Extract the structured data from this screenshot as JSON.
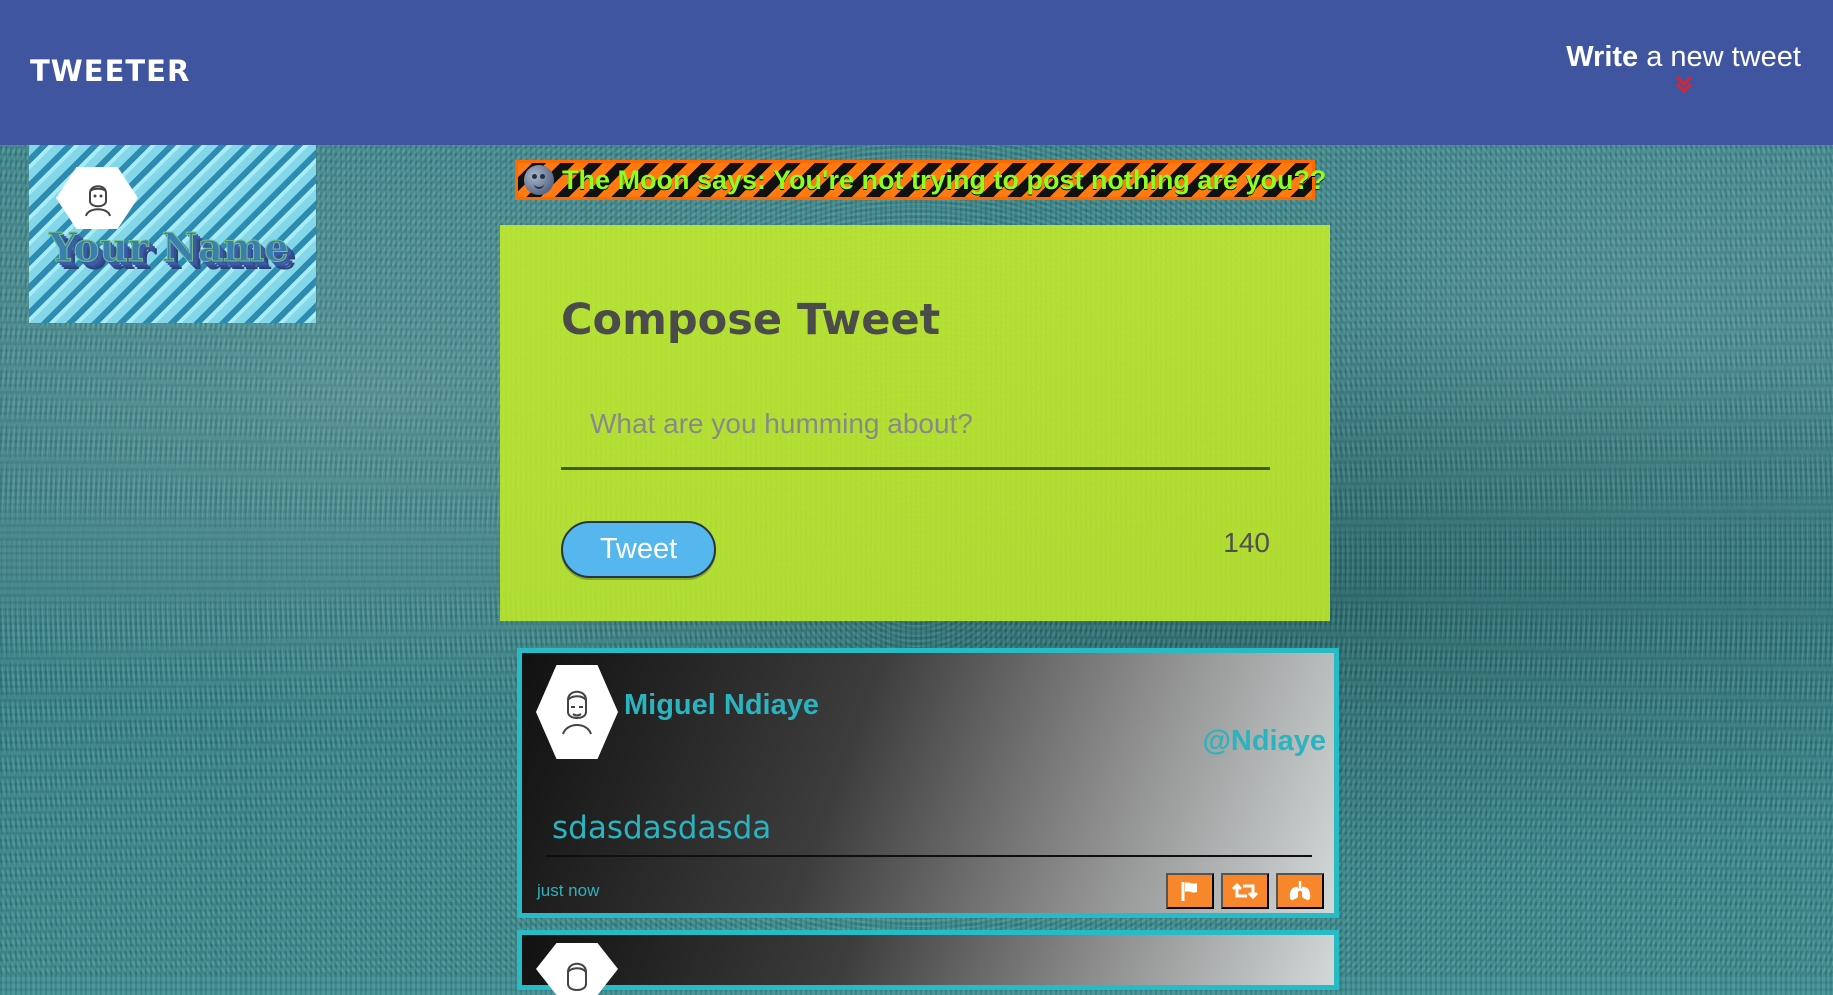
{
  "header": {
    "brand": "TWEETER",
    "compose_toggle": {
      "bold": "Write",
      "rest": "a new tweet"
    }
  },
  "profile": {
    "name": "Your Name"
  },
  "banner": {
    "text": "The Moon says: You're not trying to post nothing are you??"
  },
  "composer": {
    "title": "Compose Tweet",
    "placeholder": "What are you humming about?",
    "button_label": "Tweet",
    "remaining_characters": "140"
  },
  "feed": {
    "tweets": [
      {
        "author_name": "Miguel Ndiaye",
        "handle": "@Ndiaye",
        "content": "sdasdasdasda",
        "timestamp": "just now"
      }
    ]
  },
  "icons": {
    "flag": "flag-icon",
    "retweet": "retweet-icon",
    "lungs": "lungs-icon",
    "avatar": "avatar-icon",
    "moon": "moon-icon",
    "chevron": "double-chevron-down-icon"
  },
  "colors": {
    "header": "#4055a0",
    "composer": "#c0ea2c",
    "accent": "#27bbc6",
    "button": "#56b6ee",
    "action": "#f7872a",
    "banner_text": "#8cff20",
    "chevron": "#e0222b"
  }
}
